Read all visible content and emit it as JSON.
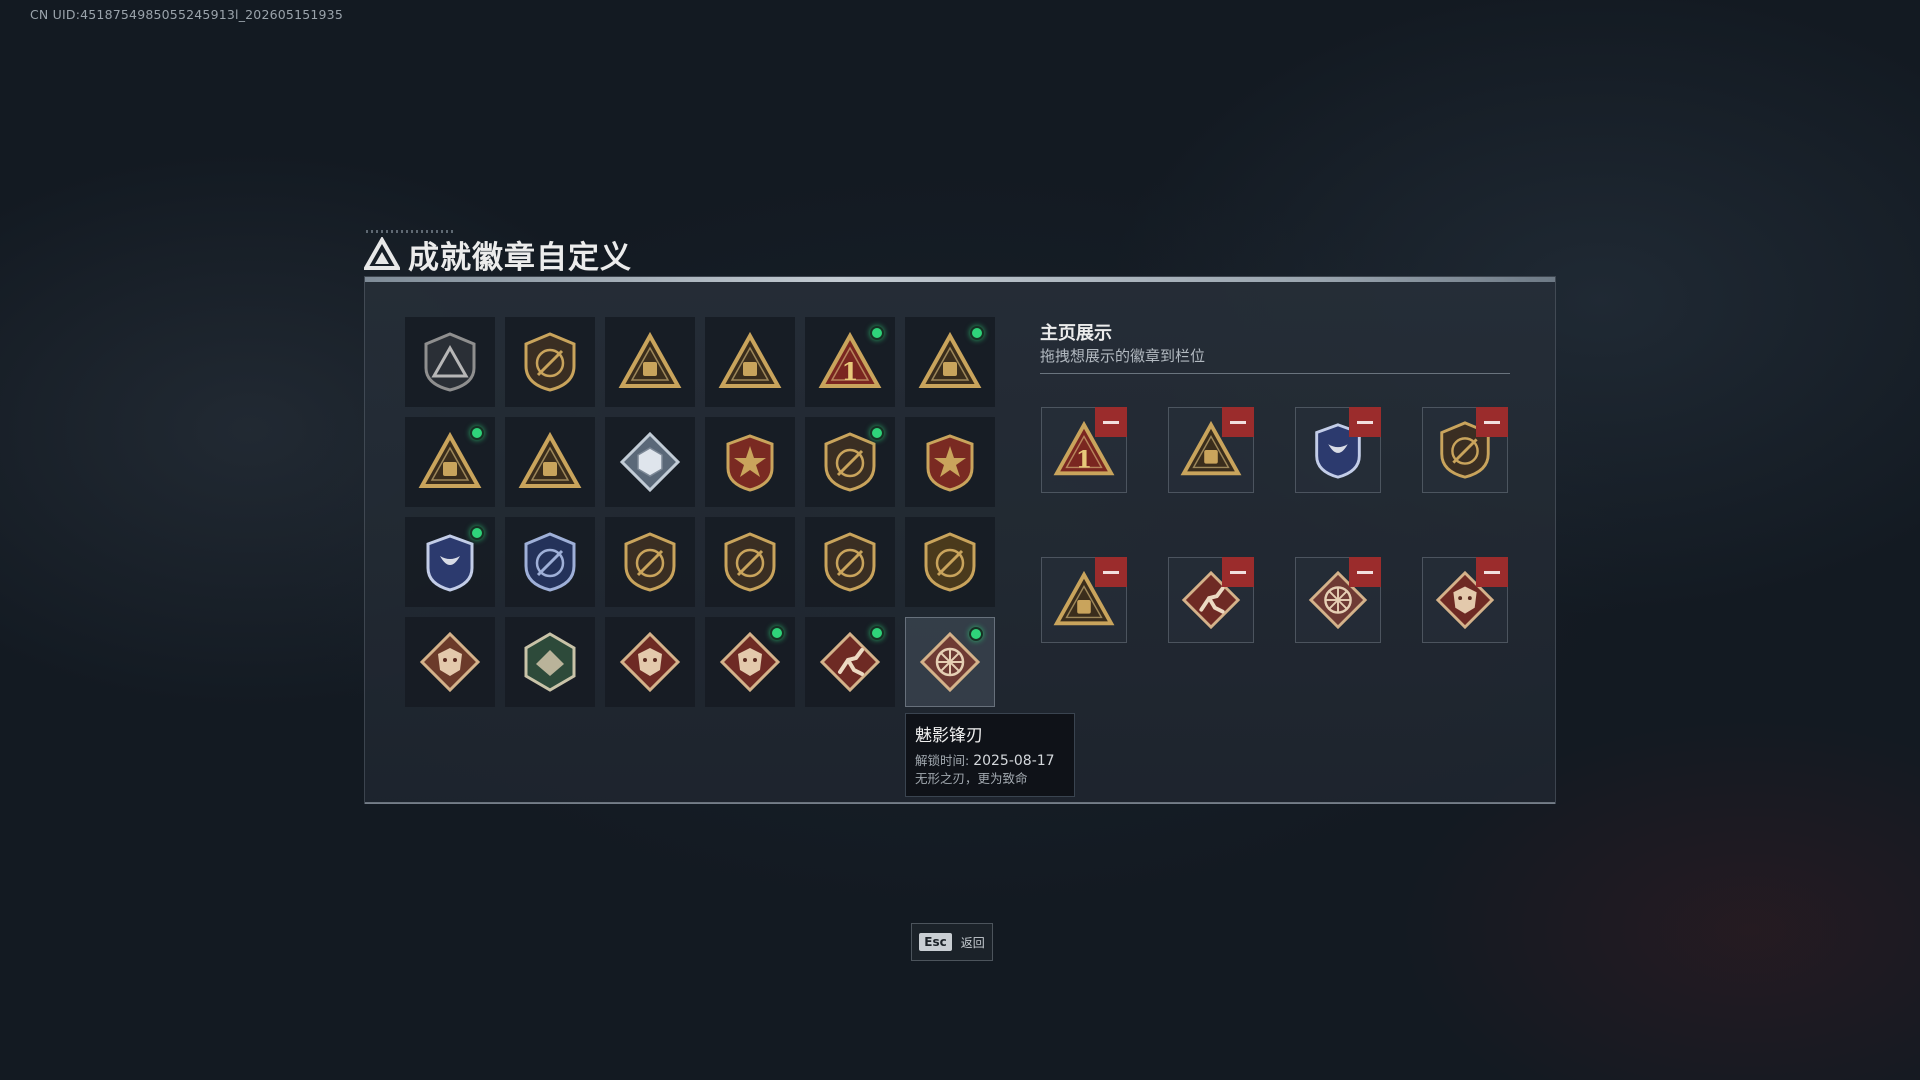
{
  "uid_text": "CN UID:4518754985055245913l_202605151935",
  "title": "成就徽章自定义",
  "colors": {
    "accent_dot": "#2fd37a",
    "remove_button": "#9b2c2c",
    "gold": "#c9a45c",
    "red_diamond": "#6e2a24"
  },
  "badges": [
    {
      "icon": "triangle-shield-badge",
      "new": false
    },
    {
      "icon": "helicopter-shield-badge",
      "new": false
    },
    {
      "icon": "gold-bag-triangle-badge",
      "new": false
    },
    {
      "icon": "gold-tank-triangle-badge",
      "new": false
    },
    {
      "icon": "number-one-triangle-badge",
      "new": true,
      "text": "1"
    },
    {
      "icon": "gold-cargo-triangle-badge",
      "new": true
    },
    {
      "icon": "gold-hands-triangle-badge",
      "new": true
    },
    {
      "icon": "gold-eagle-triangle-badge",
      "new": false
    },
    {
      "icon": "silver-cube-diamond-badge",
      "new": false
    },
    {
      "icon": "red-star-medal-badge",
      "new": false
    },
    {
      "icon": "dark-shield-crest-badge",
      "new": true
    },
    {
      "icon": "red-gold-crest-badge",
      "new": false
    },
    {
      "icon": "blue-eagle-crest-badge",
      "new": true
    },
    {
      "icon": "blue-crosshair-shield-badge",
      "new": false
    },
    {
      "icon": "bronze-rifle-shield-badge",
      "new": false
    },
    {
      "icon": "bronze-rifle-shield-badge-2",
      "new": false
    },
    {
      "icon": "bronze-rifle-shield-badge-3",
      "new": false
    },
    {
      "icon": "gold-rifle-shield-badge",
      "new": false
    },
    {
      "icon": "beast-diamond-badge",
      "new": false
    },
    {
      "icon": "green-eagle-hex-badge",
      "new": false
    },
    {
      "icon": "red-dragon-diamond-badge",
      "new": false
    },
    {
      "icon": "red-dragon-diamond-badge-2",
      "new": true
    },
    {
      "icon": "red-runner-diamond-badge",
      "new": true
    },
    {
      "icon": "phantom-blade-wheel-badge",
      "new": true,
      "selected": true
    }
  ],
  "tooltip": {
    "name": "魅影锋刃",
    "unlock_label": "解锁时间:",
    "unlock_date": "2025-08-17",
    "description": "无形之刃，更为致命"
  },
  "showcase": {
    "title": "主页展示",
    "subtitle": "拖拽想展示的徽章到栏位",
    "slots": [
      {
        "icon": "number-one-triangle-badge",
        "text": "1"
      },
      {
        "icon": "gold-cargo-triangle-badge"
      },
      {
        "icon": "blue-eagle-crest-badge"
      },
      {
        "icon": "dark-shield-crest-badge"
      },
      {
        "icon": "gold-hands-triangle-badge"
      },
      {
        "icon": "red-runner-diamond-badge"
      },
      {
        "icon": "phantom-blade-wheel-badge"
      },
      {
        "icon": "red-dragon-diamond-badge"
      }
    ]
  },
  "footer": {
    "key": "Esc",
    "label": "返回"
  }
}
